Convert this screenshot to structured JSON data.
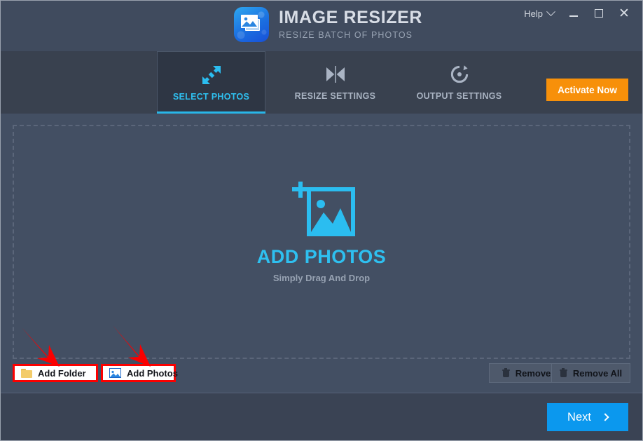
{
  "app": {
    "title": "IMAGE RESIZER",
    "subtitle": "RESIZE BATCH OF PHOTOS",
    "logo_icon": "image-stack-icon"
  },
  "titlebar": {
    "help_label": "Help",
    "help_chevron_icon": "chevron-down-icon",
    "minimize_icon": "minimize-icon",
    "maximize_icon": "maximize-icon",
    "close_icon": "close-icon",
    "close_glyph": "✕"
  },
  "nav": {
    "tabs": [
      {
        "label": "SELECT PHOTOS",
        "icon": "resize-arrows-icon",
        "active": true
      },
      {
        "label": "RESIZE SETTINGS",
        "icon": "hourglass-resize-icon",
        "active": false
      },
      {
        "label": "OUTPUT SETTINGS",
        "icon": "refresh-circle-icon",
        "active": false
      }
    ],
    "activate_label": "Activate Now",
    "active_accent_color": "#29b6e8",
    "activate_color": "#f7900a"
  },
  "dropzone": {
    "icon": "add-photo-icon",
    "title": "ADD PHOTOS",
    "subtitle": "Simply Drag And Drop",
    "title_color": "#2ec0f0"
  },
  "actions": {
    "add_folder": {
      "label": "Add Folder",
      "icon": "folder-icon",
      "highlight_color": "#fb0000"
    },
    "add_photos": {
      "label": "Add Photos",
      "icon": "photo-icon",
      "highlight_color": "#fb0000"
    },
    "remove": {
      "label": "Remove",
      "icon": "trash-icon"
    },
    "remove_all": {
      "label": "Remove All",
      "icon": "trash-icon"
    }
  },
  "footer": {
    "next_label": "Next",
    "next_chevron_icon": "chevron-right-icon",
    "next_color": "#0b98ee"
  },
  "annotations": {
    "arrow_color": "#fb0000",
    "arrows": [
      {
        "name": "arrow-to-add-folder"
      },
      {
        "name": "arrow-to-add-photos"
      }
    ]
  }
}
